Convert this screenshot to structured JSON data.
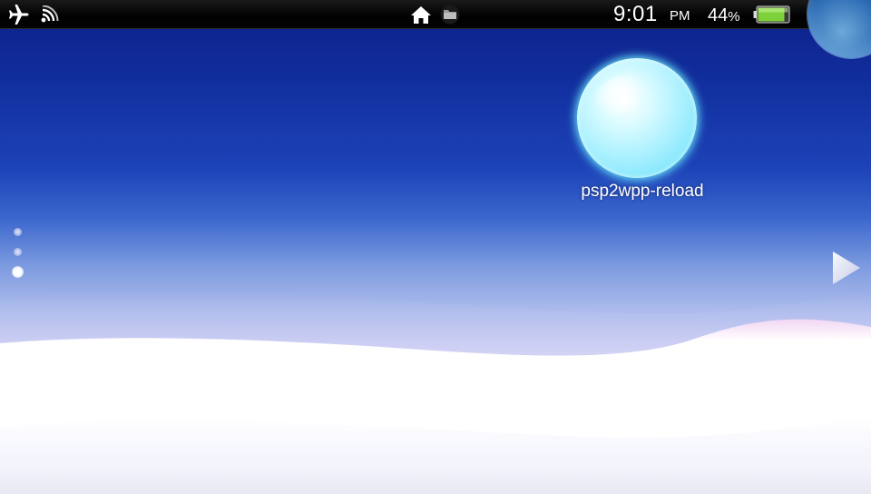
{
  "status_bar": {
    "icons": {
      "airplane": "airplane-mode-icon",
      "wifi": "wifi-signal-icon",
      "home": "home-icon",
      "folder": "content-manager-icon"
    },
    "time": "9:01",
    "ampm": "PM",
    "battery_percent": "44",
    "battery_percent_sign": "%",
    "battery_level": 0.44,
    "battery_color": "#7fd13b"
  },
  "home_screen": {
    "app": {
      "label": "psp2wpp-reload",
      "bubble_color": "#7fe6fb"
    },
    "page_indicator": {
      "page_count": 3,
      "current_page": 3
    },
    "next_page_icon": "chevron-right-icon"
  },
  "colors": {
    "background_top": "#0c1f86",
    "background_bottom": "#ffffff",
    "status_bar": "#000000"
  }
}
